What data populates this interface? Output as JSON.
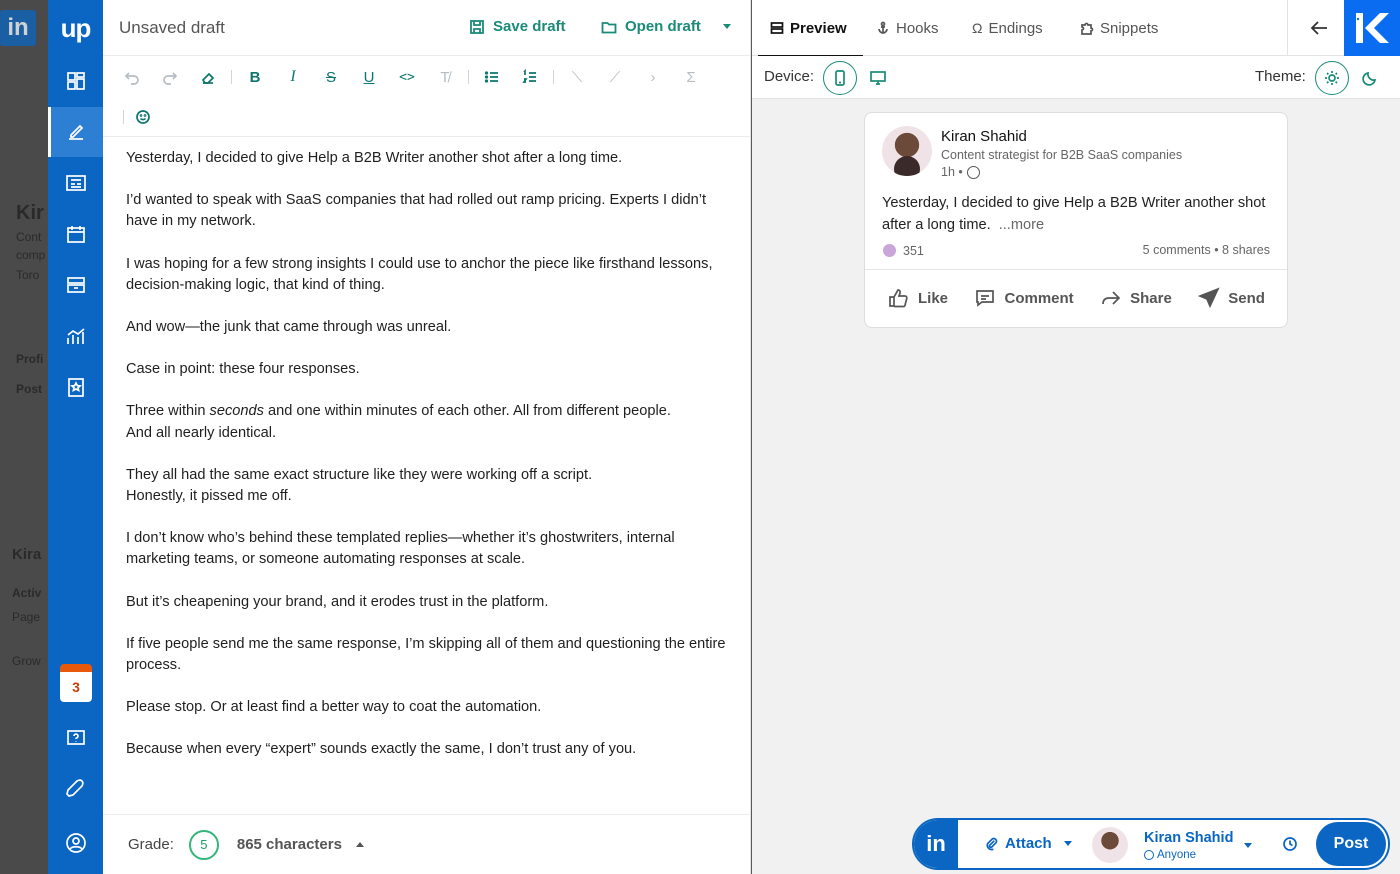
{
  "app": {
    "logo_text": "up"
  },
  "editor": {
    "draft_title": "Unsaved draft",
    "save_label": "Save draft",
    "open_label": "Open draft",
    "paragraphs": [
      "Yesterday, I decided to give Help a B2B Writer another shot after a long time.",
      "I’d wanted to speak with SaaS companies that had rolled out ramp pricing. Experts I didn’t have in my network.",
      "I was hoping for a few strong insights I could use to anchor the piece like firsthand lessons, decision-making logic, that kind of thing.",
      "And wow—the junk that came through was unreal.",
      "Case in point: these four responses.",
      "They all had the same exact structure like they were working off a script.\nHonestly, it pissed me off.",
      "I don’t know who’s behind these templated replies—whether it’s ghostwriters, internal marketing teams, or someone automating responses at scale.",
      "But it’s cheapening your brand, and it erodes trust in the platform.",
      "If five people send me the same response, I’m skipping all of them and questioning the entire process.",
      "Please stop. Or at least find a better way to coat the automation.",
      "Because when every “expert” sounds exactly the same, I don’t trust any of you."
    ],
    "paragraph_three_within": {
      "before": "Three within ",
      "emphasis": "seconds",
      "after": " and one within minutes of each other. All from different people.",
      "line2": "And all nearly identical."
    },
    "footer": {
      "grade_label": "Grade:",
      "grade_value": "5",
      "char_count": "865 characters"
    }
  },
  "rail": {
    "calendar_day": "3"
  },
  "preview": {
    "tabs": [
      {
        "label": "Preview",
        "icon": "layers-icon"
      },
      {
        "label": "Hooks",
        "icon": "anchor-icon"
      },
      {
        "label": "Endings",
        "icon": "omega-icon"
      },
      {
        "label": "Snippets",
        "icon": "puzzle-icon"
      }
    ],
    "device_label": "Device:",
    "theme_label": "Theme:",
    "post": {
      "author": "Kiran Shahid",
      "headline": "Content strategist for B2B SaaS companies",
      "time": "1h •",
      "text": "Yesterday, I decided to give Help a B2B Writer another shot after a long time.",
      "more": "...more",
      "reactions_count": "351",
      "engagement": "5 comments • 8 shares",
      "actions": [
        "Like",
        "Comment",
        "Share",
        "Send"
      ]
    }
  },
  "post_bar": {
    "li": "in",
    "attach_label": "Attach",
    "author": "Kiran Shahid",
    "visibility": "Anyone",
    "post_label": "Post"
  },
  "background": {
    "logo": "in",
    "fragments": [
      "Kir",
      "Cont",
      "comp",
      "Toro",
      "Profi",
      "Post",
      "Kira",
      "Activ",
      "Page",
      "Grow"
    ]
  },
  "colors": {
    "rail": "#0a66c2",
    "accent": "#1a8b78",
    "kb_brand": "#0a6cf0"
  }
}
